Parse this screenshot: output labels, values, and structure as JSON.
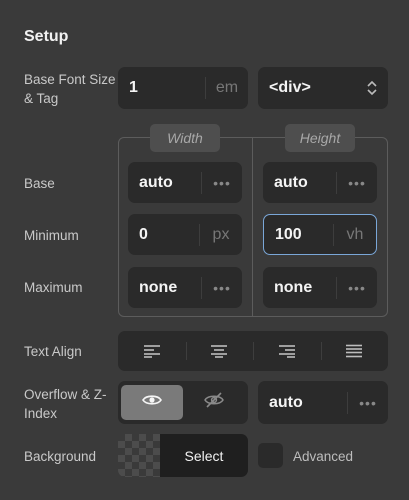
{
  "section": {
    "title": "Setup"
  },
  "base_font": {
    "label": "Base Font Size & Tag",
    "value": "1",
    "unit": "em",
    "tag": "<div>"
  },
  "dimensions": {
    "width_header": "Width",
    "height_header": "Height",
    "rows": {
      "base": {
        "label": "Base",
        "width": "auto",
        "height": "auto"
      },
      "minimum": {
        "label": "Minimum",
        "width": "0",
        "width_unit": "px",
        "height": "100",
        "height_unit": "vh"
      },
      "maximum": {
        "label": "Maximum",
        "width": "none",
        "height": "none"
      }
    }
  },
  "text_align": {
    "label": "Text Align",
    "options": [
      "align-left-icon",
      "align-center-icon",
      "align-right-icon",
      "align-justify-icon"
    ]
  },
  "overflow": {
    "label": "Overflow & Z-Index",
    "selected": "visible",
    "z_index": "auto"
  },
  "background": {
    "label": "Background",
    "select_label": "Select",
    "advanced_label": "Advanced",
    "advanced_checked": false
  },
  "colors": {
    "panel_bg": "#3a3a3a",
    "field_bg": "#2a2a2a",
    "active_border": "#7aa7d8",
    "toggle_on": "#7a7a7a"
  }
}
